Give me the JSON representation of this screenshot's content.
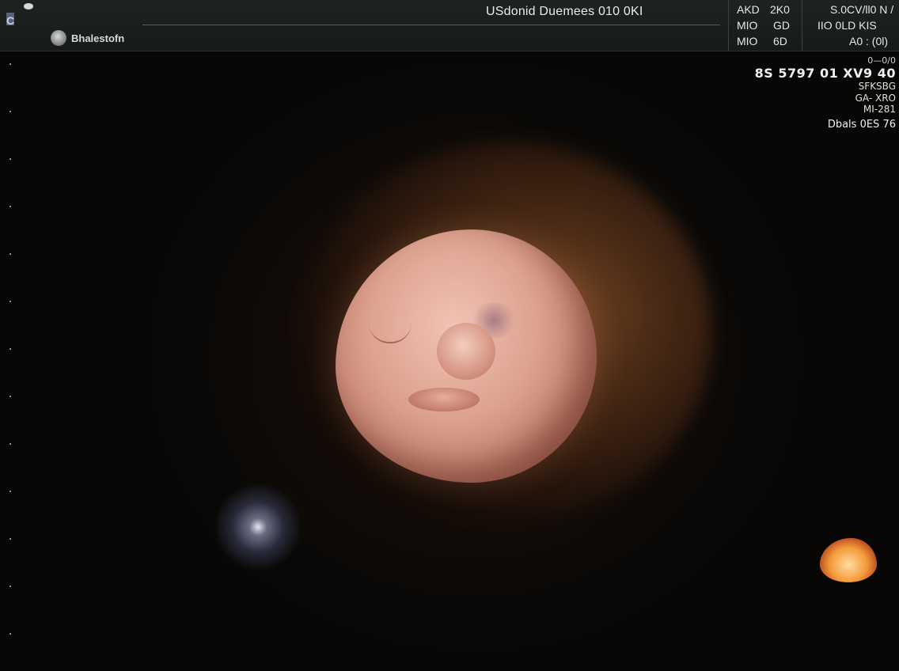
{
  "header": {
    "logo_text": "C",
    "study_title": "USdonid Duemees 010 0KI",
    "preset_label": "Bhalestofn",
    "params": [
      {
        "label": "AKD",
        "value": "2K0"
      },
      {
        "label": "MIO",
        "value": "GD"
      },
      {
        "label": "MIO",
        "value": "6D"
      }
    ],
    "params_right": [
      {
        "text": "S.0CV/ll0 N /"
      },
      {
        "text": "IIO    0LD  KIS"
      },
      {
        "text": "A0  :  (0l)"
      }
    ]
  },
  "readout": {
    "line1": "0—0/0",
    "line2": "8S 5797 01 XV9 40",
    "line3": "SFKSBG",
    "line4": "GA- XRO",
    "line5": "MI-281",
    "line6": "Dbals 0ES 76"
  },
  "icons": {
    "preset": "sphere-icon",
    "logo": "logo-icon"
  },
  "colors": {
    "background": "#0a0806",
    "header": "#1c201d",
    "text": "#e9ece8",
    "skin": "#dea391"
  }
}
